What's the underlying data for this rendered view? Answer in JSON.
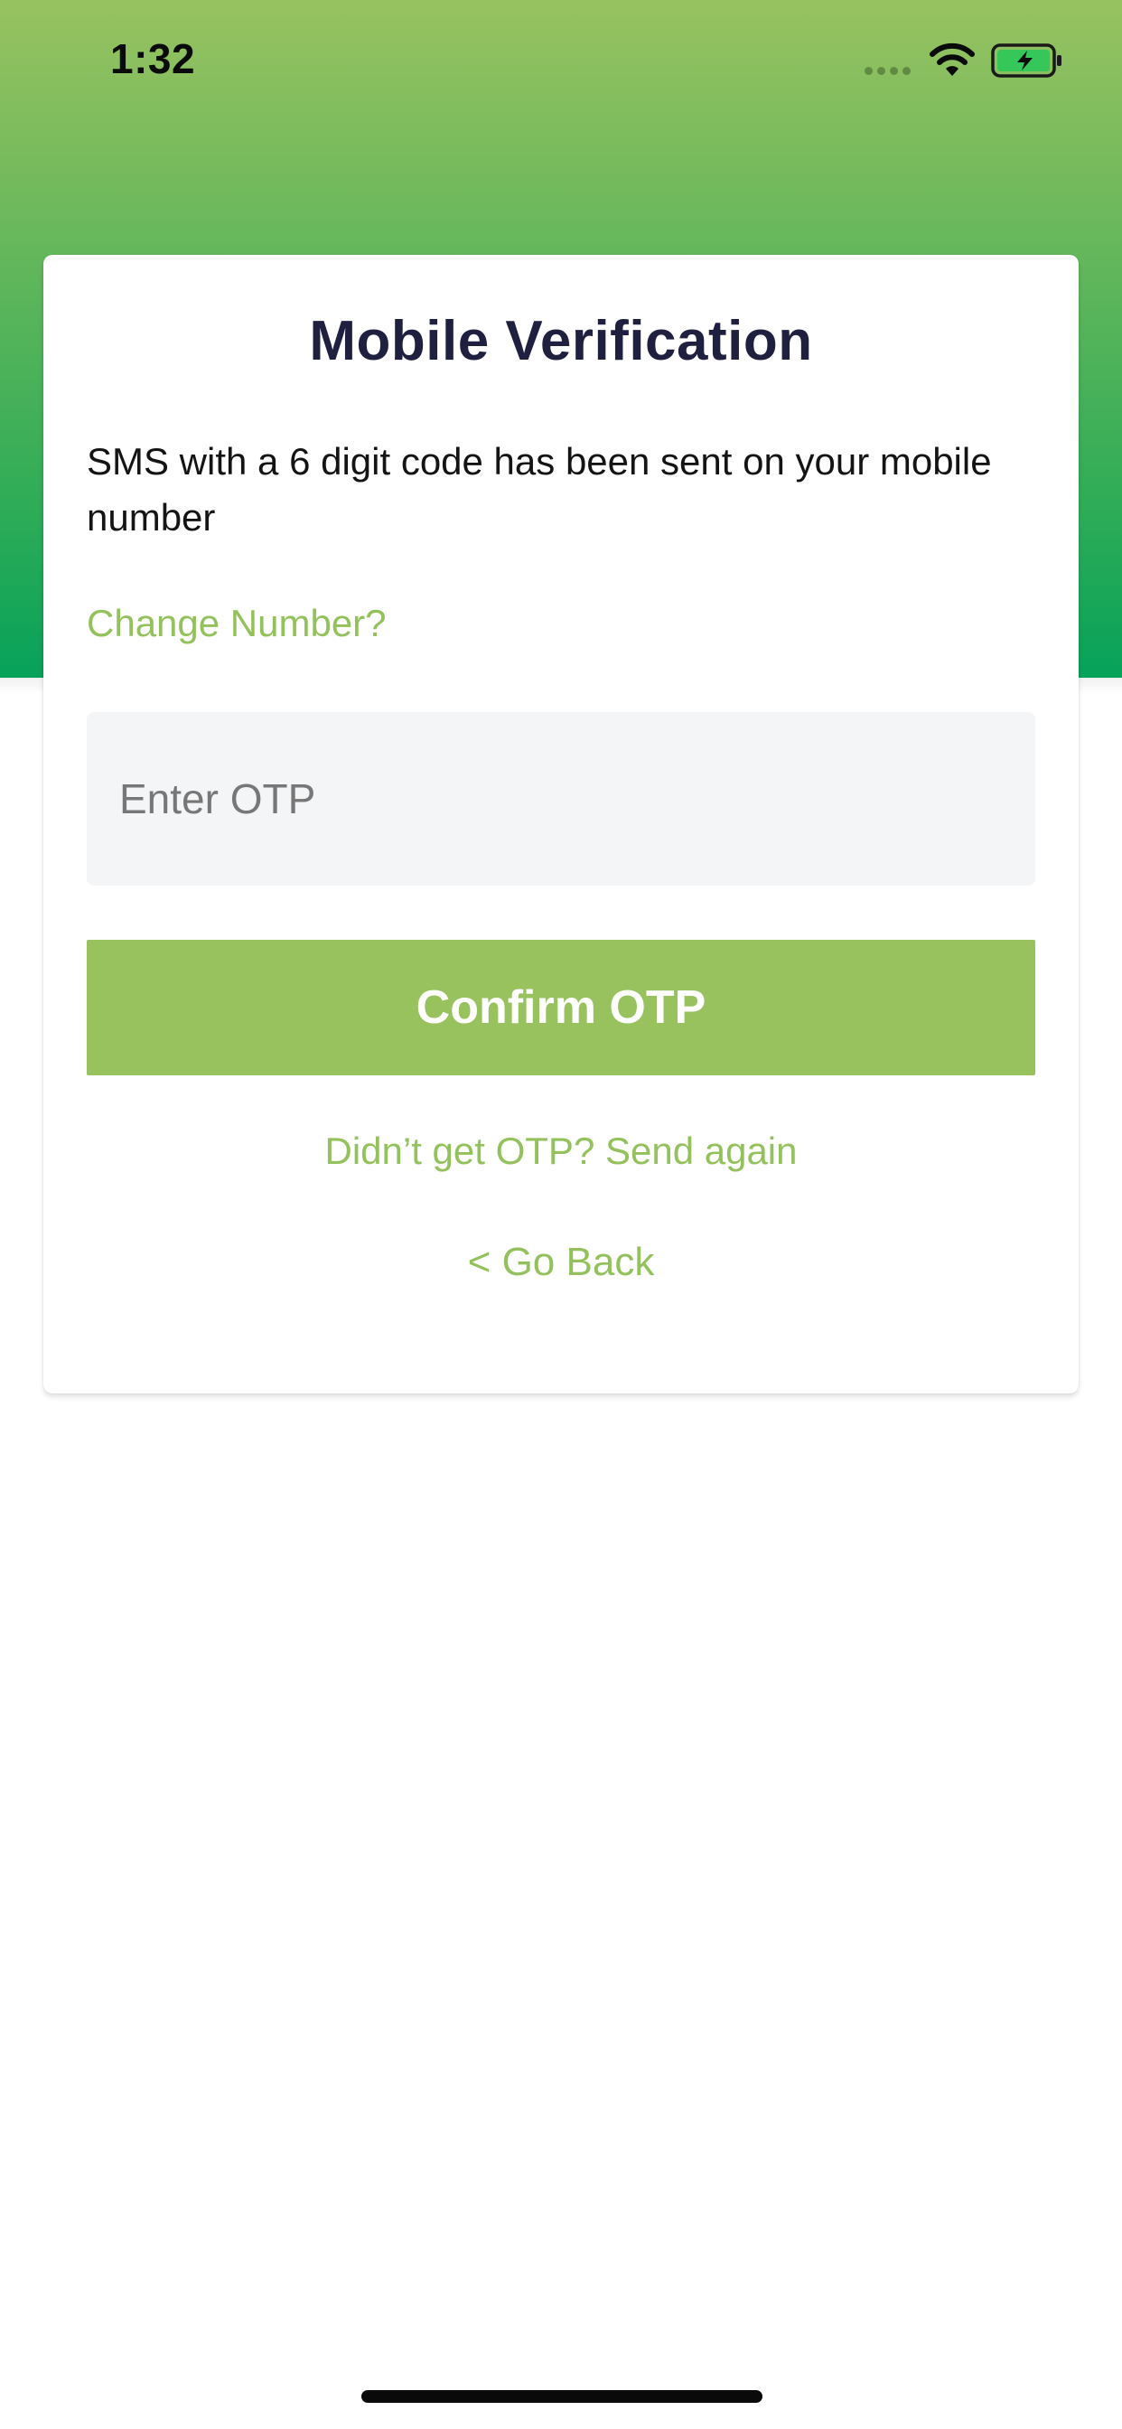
{
  "status_bar": {
    "time": "1:32",
    "icons": [
      "cellular-signal-icon",
      "wifi-icon",
      "battery-charging-icon"
    ]
  },
  "colors": {
    "header_gradient_top": "#98c260",
    "header_gradient_bottom": "#07a25a",
    "accent": "#93c25d",
    "button_bg": "#97c25e",
    "title_text": "#1f2040",
    "input_bg": "#f4f5f7"
  },
  "card": {
    "title": "Mobile Verification",
    "description": "SMS with a 6 digit code has been sent on your mobile number",
    "change_number": "Change Number?",
    "otp_input": {
      "value": "",
      "placeholder": "Enter OTP"
    },
    "confirm_button": "Confirm OTP",
    "resend_link": "Didn’t get OTP? Send again",
    "go_back_link": "< Go Back"
  }
}
